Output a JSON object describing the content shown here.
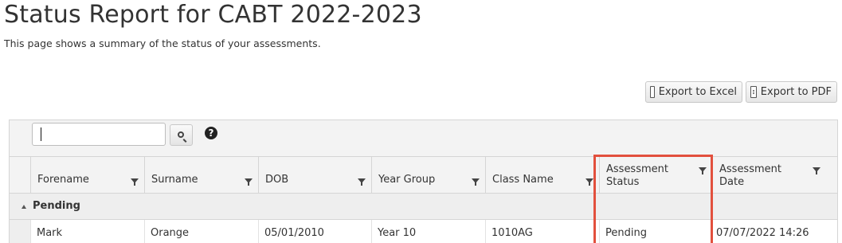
{
  "page": {
    "title": "Status Report for CABT 2022-2023",
    "subtitle": "This page shows a summary of the status of your assessments."
  },
  "toolbar": {
    "export_excel": "Export to Excel",
    "export_pdf": "Export to PDF",
    "search_value": "",
    "help_icon": "?"
  },
  "columns": [
    {
      "label": "Forename"
    },
    {
      "label": "Surname"
    },
    {
      "label": "DOB"
    },
    {
      "label": "Year Group"
    },
    {
      "label": "Class Name"
    },
    {
      "label": "Assessment Status"
    },
    {
      "label": "Assessment Date"
    }
  ],
  "group": {
    "label": "Pending"
  },
  "rows": [
    {
      "forename": "Mark",
      "surname": "Orange",
      "dob": "05/01/2010",
      "year_group": "Year 10",
      "class_name": "1010AG",
      "assessment_status": "Pending",
      "assessment_date": "07/07/2022 14:26"
    }
  ],
  "colors": {
    "highlight": "#e2503d",
    "header_bg": "#f3f3f3",
    "group_bg": "#eeeeee"
  }
}
